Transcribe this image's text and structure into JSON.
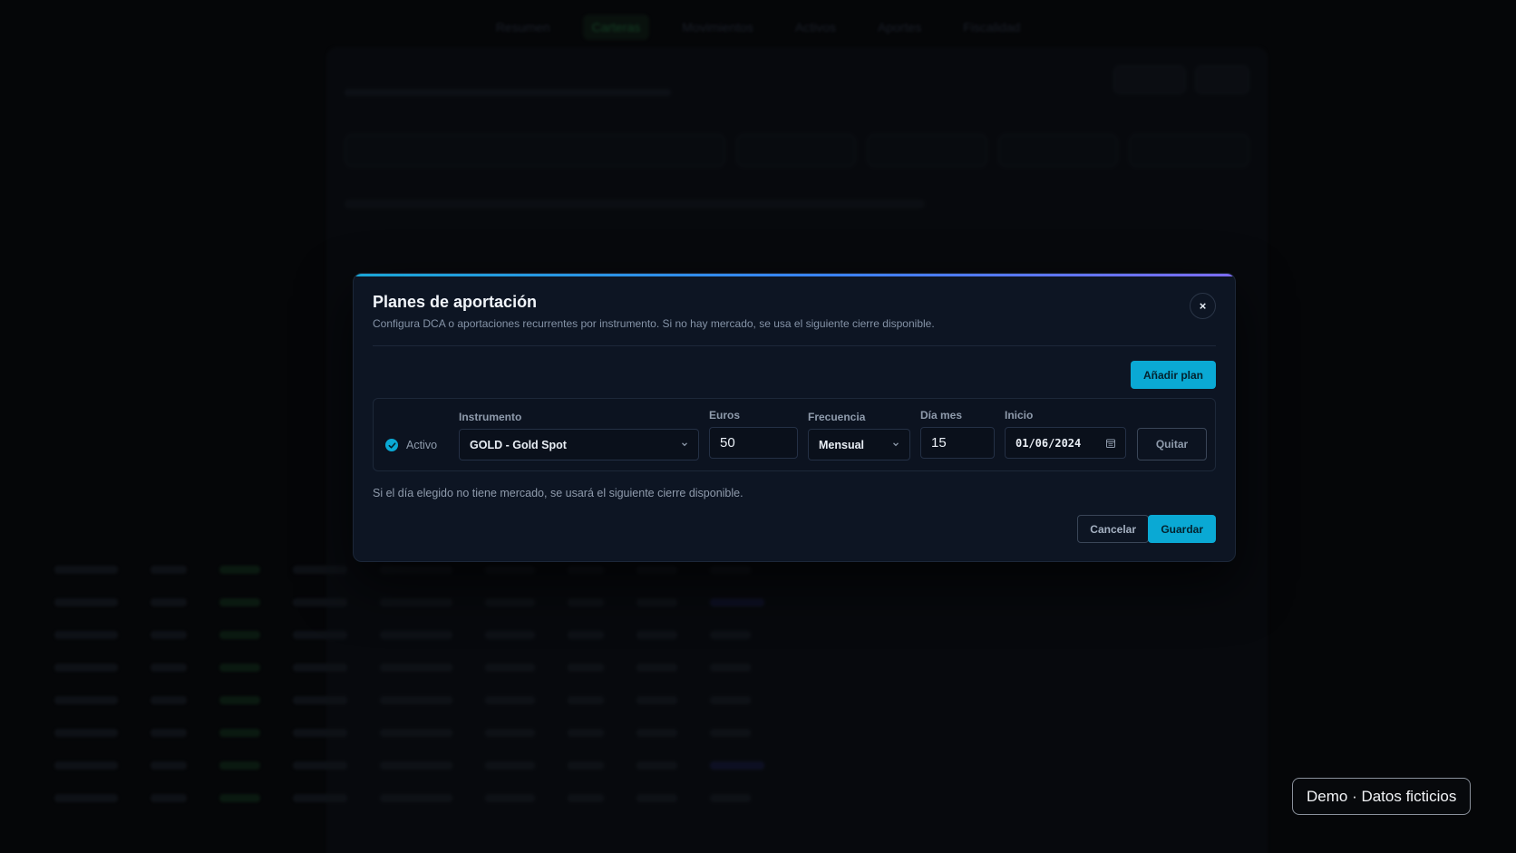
{
  "background": {
    "nav_items": [
      "Resumen",
      "Carteras",
      "Movimientos",
      "Activos",
      "Aportes",
      "Fiscalidad"
    ]
  },
  "modal": {
    "title": "Planes de aportación",
    "description": "Configura DCA o aportaciones recurrentes por instrumento. Si no hay mercado, se usa el siguiente cierre disponible.",
    "close_label": "×",
    "add_plan_label": "Añadir plan",
    "plan": {
      "active": true,
      "active_label": "Activo",
      "instrument_label": "Instrumento",
      "instrument_value": "GOLD - Gold Spot",
      "euros_label": "Euros",
      "euros_value": "50",
      "frequency_label": "Frecuencia",
      "frequency_value": "Mensual",
      "day_label": "Día mes",
      "day_value": "15",
      "start_label": "Inicio",
      "start_value": "01/06/2024",
      "remove_label": "Quitar"
    },
    "note": "Si el día elegido no tiene mercado, se usará el siguiente cierre disponible.",
    "cancel_label": "Cancelar",
    "save_label": "Guardar"
  },
  "badge": {
    "text": "Demo · Datos ficticios"
  },
  "colors": {
    "accent": "#0aa9d4",
    "modal_bg": "#0d1523",
    "page_bg": "#050608"
  }
}
